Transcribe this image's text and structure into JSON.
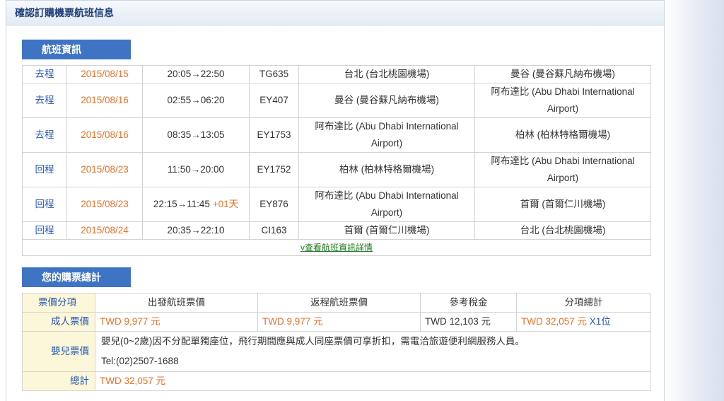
{
  "header": {
    "title": "確認訂購機票航班信息"
  },
  "flight_section": {
    "title": "航班資訊",
    "rows": [
      {
        "dir": "去程",
        "date": "2015/08/15",
        "time": "20:05→22:50",
        "plus": "",
        "flight": "TG635",
        "from": "台北 (台北桃園機場)",
        "to": "曼谷 (曼谷蘇凡納布機場)"
      },
      {
        "dir": "去程",
        "date": "2015/08/16",
        "time": "02:55→06:20",
        "plus": "",
        "flight": "EY407",
        "from": "曼谷 (曼谷蘇凡納布機場)",
        "to": "阿布達比 (Abu Dhabi International Airport)"
      },
      {
        "dir": "去程",
        "date": "2015/08/16",
        "time": "08:35→13:05",
        "plus": "",
        "flight": "EY1753",
        "from": "阿布達比 (Abu Dhabi International Airport)",
        "to": "柏林 (柏林特格爾機場)"
      },
      {
        "dir": "回程",
        "date": "2015/08/23",
        "time": "11:50→20:00",
        "plus": "",
        "flight": "EY1752",
        "from": "柏林 (柏林特格爾機場)",
        "to": "阿布達比 (Abu Dhabi International Airport)"
      },
      {
        "dir": "回程",
        "date": "2015/08/23",
        "time": "22:15→11:45",
        "plus": "+01天",
        "flight": "EY876",
        "from": "阿布達比 (Abu Dhabi International Airport)",
        "to": "首爾 (首爾仁川機場)"
      },
      {
        "dir": "回程",
        "date": "2015/08/24",
        "time": "20:35→22:10",
        "plus": "",
        "flight": "CI163",
        "from": "首爾 (首爾仁川機場)",
        "to": "台北 (台北桃園機場)"
      }
    ],
    "more_link": "v查看航班資訊詳情"
  },
  "price_section": {
    "title": "您的購票總計",
    "headers": [
      "票價分項",
      "出發航班票價",
      "返程航班票價",
      "參考稅金",
      "分項總計"
    ],
    "adult": {
      "label": "成人票價",
      "outbound": "TWD 9,977 元",
      "return": "TWD 9,977 元",
      "tax": "TWD 12,103 元",
      "subtotal": "TWD 32,057 元",
      "count": "X1位"
    },
    "infant": {
      "label": "嬰兒票價",
      "note": "嬰兒(0~2歲)因不分配單獨座位，飛行期間應與成人同座票價可享折扣，需電洽旅遊便利網服務人員。",
      "tel": "Tel:(02)2507-1688"
    },
    "total": {
      "label": "總計",
      "value": "TWD 32,057 元"
    }
  }
}
